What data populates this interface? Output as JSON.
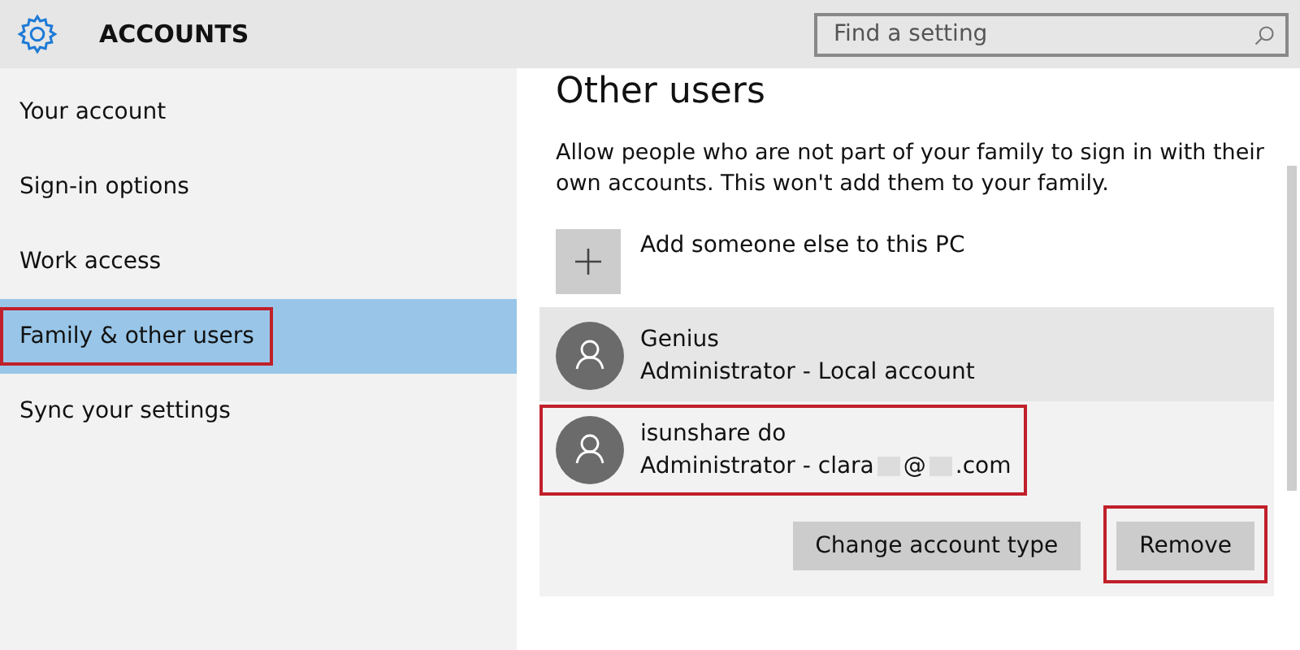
{
  "header": {
    "title": "ACCOUNTS",
    "search": {
      "placeholder": "Find a setting"
    }
  },
  "sidebar": {
    "items": [
      {
        "label": "Your account",
        "selected": false,
        "highlighted": false
      },
      {
        "label": "Sign-in options",
        "selected": false,
        "highlighted": false
      },
      {
        "label": "Work access",
        "selected": false,
        "highlighted": false
      },
      {
        "label": "Family & other users",
        "selected": true,
        "highlighted": true
      },
      {
        "label": "Sync your settings",
        "selected": false,
        "highlighted": false
      }
    ]
  },
  "content": {
    "title": "Other users",
    "description": "Allow people who are not part of your family to sign in with their own accounts. This won't add them to your family.",
    "add_button": {
      "label": "Add someone else to this PC"
    },
    "users": [
      {
        "name": "Genius",
        "detail": [
          {
            "kind": "text",
            "text": "Administrator - Local account"
          }
        ],
        "expanded": false,
        "highlighted": false
      },
      {
        "name": "isunshare do",
        "detail": [
          {
            "kind": "text",
            "text": "Administrator - clara"
          },
          {
            "kind": "redacted"
          },
          {
            "kind": "text",
            "text": "@"
          },
          {
            "kind": "redacted"
          },
          {
            "kind": "text",
            "text": ".com"
          }
        ],
        "expanded": true,
        "highlighted": true,
        "buttons": [
          {
            "label": "Change account type",
            "highlighted": false
          },
          {
            "label": "Remove",
            "highlighted": true
          }
        ]
      }
    ]
  }
}
